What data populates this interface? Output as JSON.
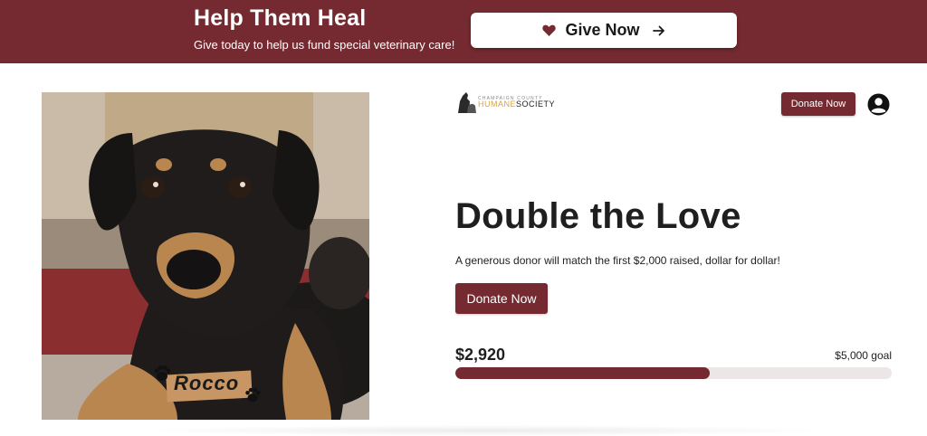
{
  "banner": {
    "title": "Help Them Heal",
    "subtitle": "Give today to help us fund special veterinary care!",
    "give_label": "Give Now"
  },
  "colors": {
    "brand": "#742a30",
    "logo_accent": "#d9a441",
    "track": "#ede6e6"
  },
  "icons": {
    "heart": "heart-icon",
    "arrow": "arrow-right-icon",
    "user": "user-account-icon",
    "paw": "paw-icon"
  },
  "photo": {
    "pet_name": "Rocco"
  },
  "header": {
    "logo_top": "CHAMPAIGN COUNTY",
    "logo_humane": "HUMANE",
    "logo_society": "SOCIETY",
    "donate_label": "Donate Now"
  },
  "hero": {
    "headline": "Double the Love",
    "description": "A generous donor will match the first $2,000 raised, dollar for dollar!",
    "donate_label": "Donate Now"
  },
  "progress": {
    "raised_text": "$2,920",
    "goal_text": "$5,000 goal",
    "fraction": 0.584
  }
}
